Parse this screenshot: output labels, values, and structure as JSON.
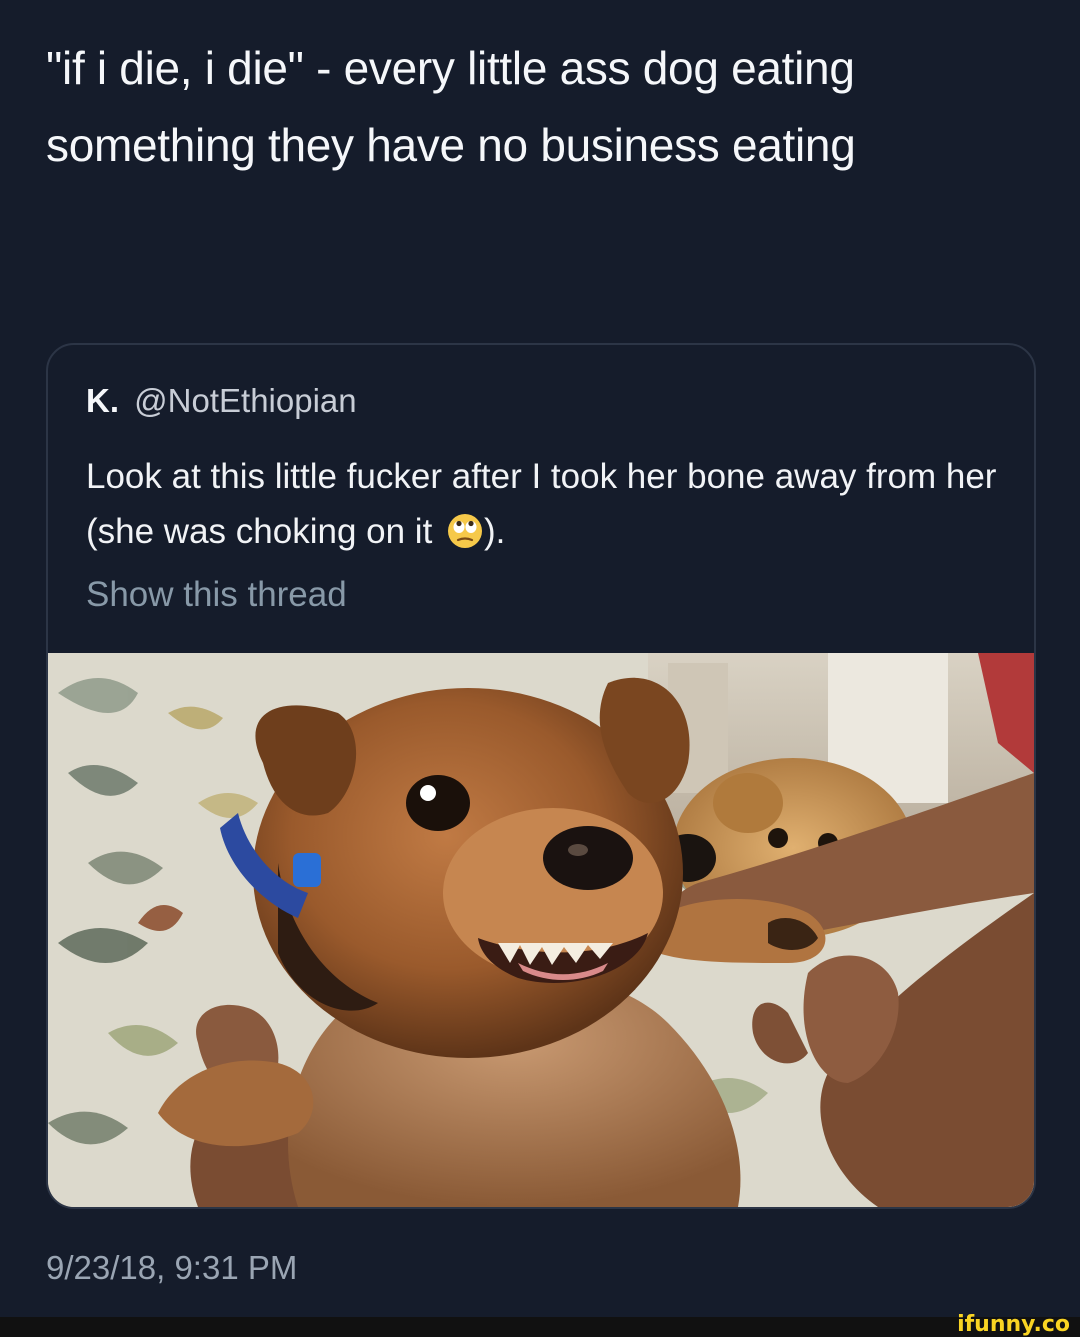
{
  "tweet": {
    "text": "\"if i die, i die\" - every little ass dog eating something they have no business eating",
    "timestamp": "9/23/18, 9:31 PM"
  },
  "quoted_tweet": {
    "name": "K.",
    "handle": "@NotEthiopian",
    "text_before_emoji": "Look at this little fucker after I took her bone away from her (she was choking on it ",
    "emoji": "face-with-rolling-eyes-icon",
    "text_after_emoji": ").",
    "show_thread": "Show this thread"
  },
  "watermark": {
    "text": "ifunny.co",
    "color": "#f9d423"
  },
  "colors": {
    "background": "#151c2b",
    "card_border": "#2c3546",
    "muted_text": "#8899a8"
  }
}
